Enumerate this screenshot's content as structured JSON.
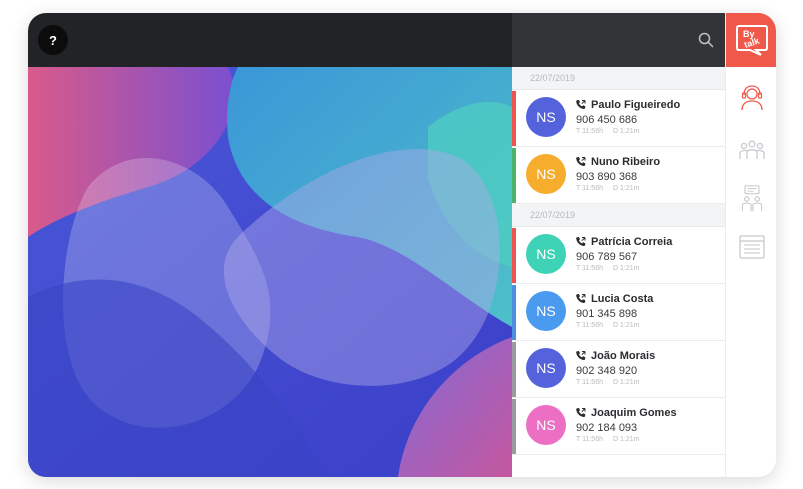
{
  "toolbar": {
    "help_label": "?"
  },
  "brand": {
    "line1": "By",
    "line2": "talk",
    "color": "#f0594a"
  },
  "contacts_panel": {
    "groups": [
      {
        "date": "22/07/2019",
        "contacts": [
          {
            "initials": "NS",
            "name": "Paulo Figueiredo",
            "number": "906 450 686",
            "time": "T 11:56h",
            "duration": "D 1:21m",
            "avatar_color": "#5462dc",
            "bar_color": "#ef5350"
          },
          {
            "initials": "NS",
            "name": "Nuno Ribeiro",
            "number": "903 890 368",
            "time": "T 11:56h",
            "duration": "D 1:21m",
            "avatar_color": "#f6ac2c",
            "bar_color": "#4cb36a"
          }
        ]
      },
      {
        "date": "22/07/2019",
        "contacts": [
          {
            "initials": "NS",
            "name": "Patrícia Correia",
            "number": "906 789 567",
            "time": "T 11:56h",
            "duration": "D 1:21m",
            "avatar_color": "#3ed3b6",
            "bar_color": "#ef5350"
          },
          {
            "initials": "NS",
            "name": "Lucia Costa",
            "number": "901 345 898",
            "time": "T 11:56h",
            "duration": "D 1:21m",
            "avatar_color": "#4a9af0",
            "bar_color": "#4a8fe0"
          },
          {
            "initials": "NS",
            "name": "João Morais",
            "number": "902 348 920",
            "time": "T 11:56h",
            "duration": "D 1:21m",
            "avatar_color": "#5462dc",
            "bar_color": "#9a9ba0"
          },
          {
            "initials": "NS",
            "name": "Joaquim Gomes",
            "number": "902 184 093",
            "time": "T 11:56h",
            "duration": "D 1:21m",
            "avatar_color": "#ec6fc4",
            "bar_color": "#9a9ba0"
          }
        ]
      }
    ]
  },
  "rail": {
    "icons": [
      "support-agent-icon",
      "team-icon",
      "conversation-icon",
      "calendar-icon"
    ],
    "active_color": "#f0594a",
    "inactive_color": "#c4c6cb"
  }
}
